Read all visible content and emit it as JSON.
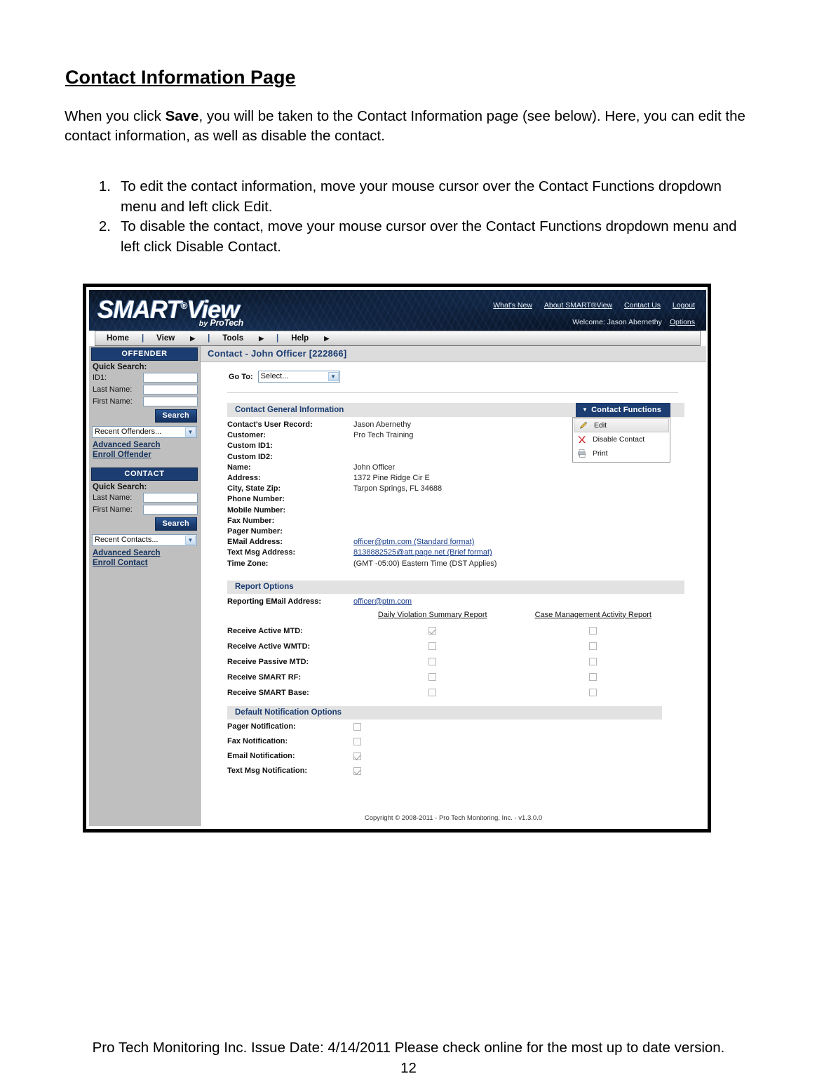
{
  "document": {
    "title": "Contact Information Page",
    "paragraph_pre": "When you click ",
    "paragraph_bold": "Save",
    "paragraph_post": ", you will be taken to the Contact Information page (see below). Here, you can edit the contact information, as well as disable the contact.",
    "list": [
      {
        "num": "1.",
        "text": "To edit the contact information, move your mouse cursor over the Contact Functions dropdown menu and left click Edit."
      },
      {
        "num": "2.",
        "text": "To disable the contact, move your mouse cursor over the Contact Functions dropdown menu and left click Disable Contact."
      }
    ],
    "footer_line": "Pro Tech Monitoring Inc. Issue Date: 4/14/2011 Please check online for the most up to date version.",
    "page_number": "12"
  },
  "app": {
    "logo": {
      "main": "SMART",
      "reg": "®",
      "view": "View",
      "by": "by",
      "brand": "ProTech"
    },
    "top_links": [
      {
        "label": "What's New",
        "name": "whats-new-link"
      },
      {
        "label": "About SMART®View",
        "name": "about-smartview-link"
      },
      {
        "label": "Contact Us",
        "name": "contact-us-link"
      },
      {
        "label": "Logout",
        "name": "logout-link"
      }
    ],
    "welcome": "Welcome: Jason Abernethy",
    "options_link": "Options",
    "menu": [
      {
        "label": "Home",
        "has_arrow": false
      },
      {
        "label": "View",
        "has_arrow": true
      },
      {
        "label": "Tools",
        "has_arrow": true
      },
      {
        "label": "Help",
        "has_arrow": true
      }
    ],
    "page_title": "Contact - John Officer [222866]",
    "copyright": "Copyright © 2008-2011 - Pro Tech Monitoring, Inc. - v1.3.0.0",
    "colors": {
      "brand_navy": "#1b3d71",
      "banner_dark": "#0b1524",
      "sidebar_gray": "#bfbfbf",
      "section_gray": "#e2e2e2",
      "link_blue": "#1a3e8c"
    }
  },
  "sidebar": {
    "offender": {
      "header": "OFFENDER",
      "quick_search_label": "Quick Search:",
      "fields": [
        {
          "label": "ID1:",
          "value": ""
        },
        {
          "label": "Last Name:",
          "value": ""
        },
        {
          "label": "First Name:",
          "value": ""
        }
      ],
      "search_button": "Search",
      "select_value": "Recent Offenders...",
      "links": [
        "Advanced Search",
        "Enroll Offender"
      ]
    },
    "contact": {
      "header": "CONTACT",
      "quick_search_label": "Quick Search:",
      "fields": [
        {
          "label": "Last Name:",
          "value": ""
        },
        {
          "label": "First Name:",
          "value": ""
        }
      ],
      "search_button": "Search",
      "select_value": "Recent Contacts...",
      "links": [
        "Advanced Search",
        "Enroll Contact"
      ]
    }
  },
  "main": {
    "goto_label": "Go To:",
    "goto_value": "Select...",
    "general_section": {
      "header": "Contact General Information",
      "functions_button": "Contact Functions",
      "functions_menu": [
        {
          "label": "Edit",
          "icon": "pencil-icon",
          "highlighted": true
        },
        {
          "label": "Disable Contact",
          "icon": "red-x-icon",
          "highlighted": false
        },
        {
          "label": "Print",
          "icon": "printer-icon",
          "highlighted": false
        }
      ],
      "fields": [
        {
          "label": "Contact's User Record:",
          "value": "Jason Abernethy",
          "link": false
        },
        {
          "label": "Customer:",
          "value": "Pro Tech Training",
          "link": false
        },
        {
          "label": "Custom ID1:",
          "value": "",
          "link": false
        },
        {
          "label": "Custom ID2:",
          "value": "",
          "link": false
        },
        {
          "label": "Name:",
          "value": "John Officer",
          "link": false
        },
        {
          "label": "Address:",
          "value": "1372 Pine Ridge Cir E",
          "link": false
        },
        {
          "label": "City, State Zip:",
          "value": "Tarpon Springs, FL 34688",
          "link": false
        },
        {
          "label": "Phone Number:",
          "value": "",
          "link": false
        },
        {
          "label": "Mobile Number:",
          "value": "",
          "link": false
        },
        {
          "label": "Fax Number:",
          "value": "",
          "link": false
        },
        {
          "label": "Pager Number:",
          "value": "",
          "link": false
        },
        {
          "label": "EMail Address:",
          "value": "officer@ptm.com (Standard format)",
          "link": true
        },
        {
          "label": "Text Msg Address:",
          "value": "8138882525@att.page.net (Brief format)",
          "link": true
        },
        {
          "label": "Time Zone:",
          "value": "(GMT -05:00) Eastern Time (DST Applies)",
          "link": false
        }
      ]
    },
    "report_options": {
      "header": "Report Options",
      "reporting_email_label": "Reporting EMail Address:",
      "reporting_email_value": "officer@ptm.com",
      "columns": [
        "Daily Violation Summary Report",
        "Case Management Activity Report"
      ],
      "rows": [
        {
          "label": "Receive Active MTD:",
          "daily": true,
          "case": false
        },
        {
          "label": "Receive Active WMTD:",
          "daily": false,
          "case": false
        },
        {
          "label": "Receive Passive MTD:",
          "daily": false,
          "case": false
        },
        {
          "label": "Receive SMART RF:",
          "daily": false,
          "case": false
        },
        {
          "label": "Receive SMART Base:",
          "daily": false,
          "case": false
        }
      ]
    },
    "notification_options": {
      "header": "Default Notification Options",
      "rows": [
        {
          "label": "Pager Notification:",
          "checked": false
        },
        {
          "label": "Fax Notification:",
          "checked": false
        },
        {
          "label": "Email Notification:",
          "checked": true
        },
        {
          "label": "Text Msg Notification:",
          "checked": true
        }
      ]
    }
  }
}
